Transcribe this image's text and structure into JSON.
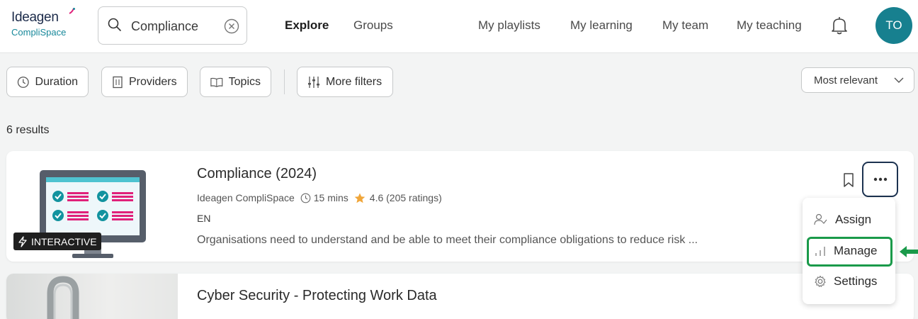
{
  "header": {
    "logo_top": "Ideagen",
    "logo_bottom": "CompliSpace",
    "search_value": "Compliance",
    "nav": [
      "Explore",
      "Groups",
      "My playlists",
      "My learning",
      "My team",
      "My teaching"
    ],
    "avatar_initials": "TO"
  },
  "filters": {
    "duration": "Duration",
    "providers": "Providers",
    "topics": "Topics",
    "more_filters": "More filters",
    "sort": "Most relevant"
  },
  "results_count": "6 results",
  "cards": [
    {
      "title": "Compliance (2024)",
      "provider": "Ideagen CompliSpace",
      "duration": "15 mins",
      "rating": "4.6 (205 ratings)",
      "language": "EN",
      "description": "Organisations need to understand and be able to meet their compliance obligations to reduce risk ...",
      "badge": "INTERACTIVE"
    },
    {
      "title": "Cyber Security - Protecting Work Data"
    }
  ],
  "menu": {
    "assign": "Assign",
    "manage": "Manage",
    "settings": "Settings"
  },
  "colors": {
    "brand": "#17808f",
    "highlight": "#1a9a4a",
    "star": "#f0a63a"
  },
  "icons": [
    "search-icon",
    "clear-icon",
    "bell-icon",
    "clock-icon",
    "building-icon",
    "book-icon",
    "sliders-icon",
    "chevron-down-icon",
    "bolt-icon",
    "star-icon",
    "bookmark-icon",
    "more-icon",
    "assign-user-icon",
    "chart-icon",
    "gear-icon",
    "arrow-left-icon"
  ]
}
